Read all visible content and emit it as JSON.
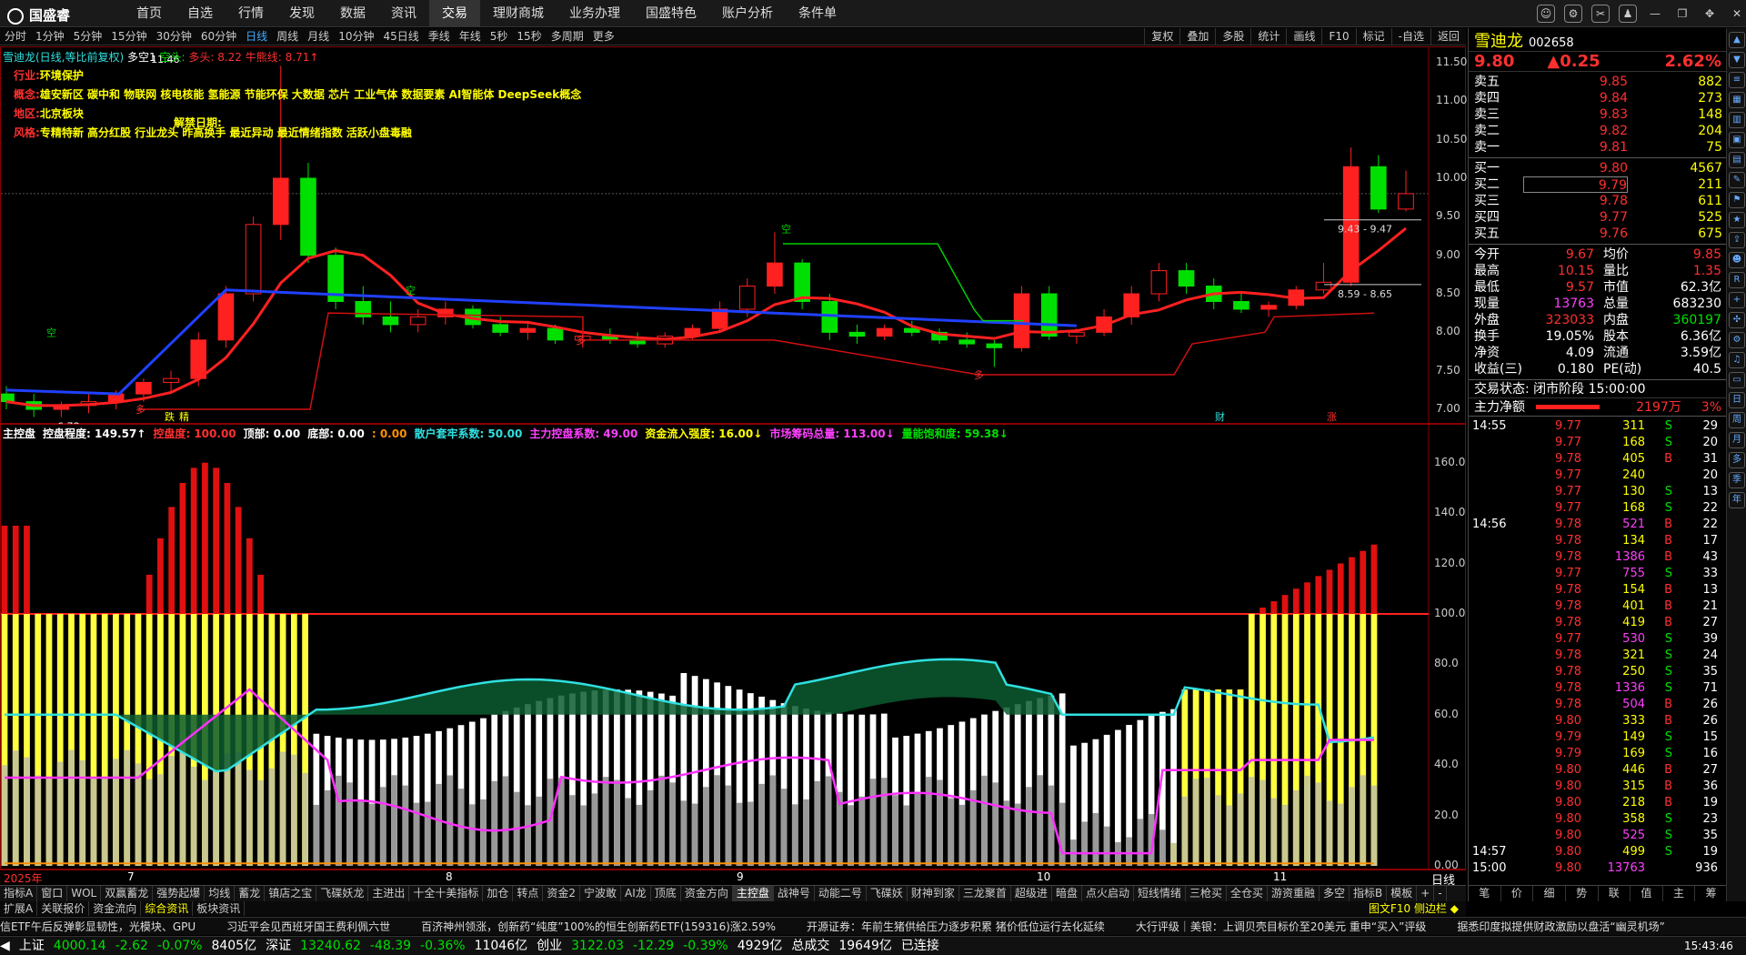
{
  "app": {
    "logo": "国盛睿",
    "nav": [
      "首页",
      "自选",
      "行情",
      "发现",
      "数据",
      "资讯",
      "交易",
      "理财商城",
      "业务办理",
      "国盛特色",
      "账户分析",
      "条件单"
    ],
    "nav_active": 6,
    "time": "15:43:46"
  },
  "period_bar": {
    "items": [
      "分时",
      "1分钟",
      "5分钟",
      "15分钟",
      "30分钟",
      "60分钟",
      "日线",
      "周线",
      "月线",
      "10分钟",
      "45日线",
      "季线",
      "年线",
      "5秒",
      "15秒",
      "多周期",
      "更多"
    ],
    "active": 6,
    "right_items": [
      "复权",
      "叠加",
      "多股",
      "统计",
      "画线",
      "F10",
      "标记",
      "-自选",
      "返回"
    ]
  },
  "main_chart": {
    "title": "雪迪龙(日线,等比前复权)",
    "mode_label": "多空1",
    "kong_label": "空头:",
    "duo_label": "多头: 8.22",
    "niu_label": "牛熊线: 8.71↑",
    "info_lines": [
      {
        "label": "行业:",
        "value": "环境保护"
      },
      {
        "label": "概念:",
        "value": "雄安新区 碳中和 物联网 核电核能 氢能源 节能环保 大数据 芯片 工业气体 数据要素 AI智能体 DeepSeek概念"
      },
      {
        "label": "地区:",
        "value": "北京板块"
      },
      {
        "label": "风格:",
        "value": "专精特新 高分红股 行业龙头 昨高换手 最近异动 最近情绪指数 活跃小盘毒融"
      }
    ],
    "jiejin_label": "解禁日期:",
    "y_ticks": [
      "11.50",
      "11.00",
      "10.50",
      "10.00",
      "9.50",
      "9.00",
      "8.50",
      "8.00",
      "7.50",
      "7.00"
    ],
    "annotations": {
      "high": "11.46",
      "low": "6.78",
      "range1": "9.43 - 9.47",
      "range2": "8.59 - 8.65",
      "kong_marker": "空",
      "duo_marker": "多",
      "die": "跌",
      "jing": "精",
      "cai": "财",
      "zhang": "涨"
    }
  },
  "chart_data": [
    {
      "type": "candlestick",
      "title": "雪迪龙(日线,等比前复权)",
      "ylim": [
        6.8,
        11.7
      ],
      "y_ticks": [
        11.5,
        11.0,
        10.5,
        10.0,
        9.5,
        9.0,
        8.5,
        8.0,
        7.5,
        7.0
      ],
      "x_ticks": [
        "2025年",
        "7",
        "8",
        "9",
        "10",
        "11"
      ],
      "ohlc_approx": [
        [
          7.2,
          7.3,
          7.0,
          7.1
        ],
        [
          7.1,
          7.2,
          6.9,
          7.0
        ],
        [
          7.0,
          7.1,
          6.9,
          7.05
        ],
        [
          7.05,
          7.2,
          6.95,
          7.1
        ],
        [
          7.1,
          7.25,
          7.0,
          7.2
        ],
        [
          7.2,
          7.4,
          7.1,
          7.35
        ],
        [
          7.35,
          7.5,
          7.2,
          7.4
        ],
        [
          7.4,
          8.0,
          7.3,
          7.9
        ],
        [
          7.9,
          8.6,
          7.8,
          8.5
        ],
        [
          8.5,
          9.5,
          8.4,
          9.4
        ],
        [
          9.4,
          11.46,
          9.2,
          10.0
        ],
        [
          10.0,
          10.2,
          8.9,
          9.0
        ],
        [
          9.0,
          9.1,
          8.3,
          8.4
        ],
        [
          8.4,
          8.6,
          8.1,
          8.2
        ],
        [
          8.2,
          8.4,
          8.0,
          8.1
        ],
        [
          8.1,
          8.3,
          8.0,
          8.2
        ],
        [
          8.2,
          8.4,
          8.1,
          8.3
        ],
        [
          8.3,
          8.35,
          8.05,
          8.1
        ],
        [
          8.1,
          8.2,
          7.95,
          8.0
        ],
        [
          8.0,
          8.15,
          7.9,
          8.05
        ],
        [
          8.05,
          8.1,
          7.85,
          7.9
        ],
        [
          7.9,
          8.05,
          7.8,
          7.95
        ],
        [
          7.95,
          8.05,
          7.85,
          7.9
        ],
        [
          7.9,
          8.0,
          7.8,
          7.85
        ],
        [
          7.85,
          8.0,
          7.8,
          7.95
        ],
        [
          7.95,
          8.1,
          7.9,
          8.05
        ],
        [
          8.05,
          8.4,
          8.0,
          8.3
        ],
        [
          8.3,
          8.7,
          8.2,
          8.6
        ],
        [
          8.6,
          9.3,
          8.5,
          8.9
        ],
        [
          8.9,
          8.95,
          8.3,
          8.4
        ],
        [
          8.4,
          8.5,
          7.9,
          8.0
        ],
        [
          8.0,
          8.1,
          7.85,
          7.95
        ],
        [
          7.95,
          8.1,
          7.9,
          8.05
        ],
        [
          8.05,
          8.15,
          7.95,
          8.0
        ],
        [
          8.0,
          8.05,
          7.85,
          7.9
        ],
        [
          7.9,
          8.0,
          7.8,
          7.85
        ],
        [
          7.85,
          7.9,
          7.55,
          7.8
        ],
        [
          7.8,
          8.6,
          7.75,
          8.5
        ],
        [
          8.5,
          8.6,
          7.9,
          7.95
        ],
        [
          7.95,
          8.05,
          7.85,
          8.0
        ],
        [
          8.0,
          8.3,
          7.95,
          8.2
        ],
        [
          8.2,
          8.6,
          8.1,
          8.5
        ],
        [
          8.5,
          8.9,
          8.4,
          8.8
        ],
        [
          8.8,
          8.9,
          8.5,
          8.6
        ],
        [
          8.6,
          8.7,
          8.3,
          8.4
        ],
        [
          8.4,
          8.5,
          8.25,
          8.3
        ],
        [
          8.3,
          8.4,
          8.2,
          8.35
        ],
        [
          8.35,
          8.6,
          8.3,
          8.55
        ],
        [
          8.55,
          8.9,
          8.5,
          8.65
        ],
        [
          8.65,
          10.4,
          8.6,
          10.15
        ],
        [
          10.15,
          10.3,
          9.55,
          9.6
        ],
        [
          9.6,
          10.1,
          9.57,
          9.8
        ]
      ]
    },
    {
      "type": "bar",
      "title": "主控盘",
      "ylim": [
        0,
        170
      ],
      "y_ticks": [
        160,
        140,
        120,
        100,
        80,
        60,
        40,
        20,
        0
      ],
      "series": [
        {
          "name": "控盘程度",
          "value": "149.57"
        },
        {
          "name": "控盘度",
          "value": "100.00"
        },
        {
          "name": "顶部",
          "value": "0.00"
        },
        {
          "name": "底部",
          "value": "0.00"
        },
        {
          "name": "散户套牢系数",
          "value": "50.00"
        },
        {
          "name": "主力控盘系数",
          "value": "49.00"
        },
        {
          "name": "资金流入强度",
          "value": "16.00"
        },
        {
          "name": "市场筹码总量",
          "value": "113.00"
        },
        {
          "name": "量能饱和度",
          "value": "59.38"
        }
      ]
    }
  ],
  "sub_chart": {
    "title": "主控盘",
    "items": [
      {
        "text": "控盘程度: 149.57↑",
        "color": "white"
      },
      {
        "text": "控盘度: 100.00",
        "color": "red"
      },
      {
        "text": "顶部: 0.00",
        "color": "white"
      },
      {
        "text": "底部: 0.00",
        "color": "white"
      },
      {
        "text": ": 0.00",
        "color": "orange"
      },
      {
        "text": "散户套牢系数: 50.00",
        "color": "cyan"
      },
      {
        "text": "主力控盘系数: 49.00",
        "color": "mag"
      },
      {
        "text": "资金流入强度: 16.00↓",
        "color": "yellow"
      },
      {
        "text": "市场筹码总量: 113.00↓",
        "color": "mag"
      },
      {
        "text": "量能饱和度: 59.38↓",
        "color": "green"
      }
    ],
    "y_ticks": [
      "160.0",
      "140.0",
      "120.0",
      "100.0",
      "80.0",
      "60.0",
      "40.0",
      "20.0",
      "0.00"
    ],
    "x_labels": [
      "2025年",
      "7",
      "8",
      "9",
      "10",
      "11"
    ],
    "x_right_label": "日线"
  },
  "quote": {
    "name": "雪迪龙",
    "code": "002658",
    "price": "9.80",
    "change": "▲0.25",
    "change_pct": "2.62%",
    "asks": [
      {
        "label": "卖五",
        "price": "9.85",
        "vol": "882"
      },
      {
        "label": "卖四",
        "price": "9.84",
        "vol": "273"
      },
      {
        "label": "卖三",
        "price": "9.83",
        "vol": "148"
      },
      {
        "label": "卖二",
        "price": "9.82",
        "vol": "204"
      },
      {
        "label": "卖一",
        "price": "9.81",
        "vol": "75"
      }
    ],
    "bids": [
      {
        "label": "买一",
        "price": "9.80",
        "vol": "4567"
      },
      {
        "label": "买二",
        "price": "9.79",
        "vol": "211"
      },
      {
        "label": "买三",
        "price": "9.78",
        "vol": "611"
      },
      {
        "label": "买四",
        "price": "9.77",
        "vol": "525"
      },
      {
        "label": "买五",
        "price": "9.76",
        "vol": "675"
      }
    ],
    "stats": [
      {
        "l1": "今开",
        "v1": "9.67",
        "c1": "red",
        "l2": "均价",
        "v2": "9.85",
        "c2": "red"
      },
      {
        "l1": "最高",
        "v1": "10.15",
        "c1": "red",
        "l2": "量比",
        "v2": "1.35",
        "c2": "red"
      },
      {
        "l1": "最低",
        "v1": "9.57",
        "c1": "red",
        "l2": "市值",
        "v2": "62.3亿",
        "c2": "white"
      },
      {
        "l1": "现量",
        "v1": "13763",
        "c1": "mag",
        "l2": "总量",
        "v2": "683230",
        "c2": "white"
      },
      {
        "l1": "外盘",
        "v1": "323033",
        "c1": "red",
        "l2": "内盘",
        "v2": "360197",
        "c2": "green"
      },
      {
        "l1": "换手",
        "v1": "19.05%",
        "c1": "white",
        "l2": "股本",
        "v2": "6.36亿",
        "c2": "white"
      },
      {
        "l1": "净资",
        "v1": "4.09",
        "c1": "white",
        "l2": "流通",
        "v2": "3.59亿",
        "c2": "white"
      },
      {
        "l1": "收益(三)",
        "v1": "0.180",
        "c1": "white",
        "l2": "PE(动)",
        "v2": "40.5",
        "c2": "white"
      }
    ],
    "trade_status": "交易状态: 闭市阶段 15:00:00",
    "net_label": "主力净额",
    "net_value": "2197万",
    "net_pct": "3%",
    "ticks": [
      {
        "t": "14:55",
        "p": "9.77",
        "v": "311",
        "d": "S",
        "n": "29"
      },
      {
        "t": "",
        "p": "9.77",
        "v": "168",
        "d": "S",
        "n": "20"
      },
      {
        "t": "",
        "p": "9.78",
        "v": "405",
        "d": "B",
        "n": "31"
      },
      {
        "t": "",
        "p": "9.77",
        "v": "240",
        "d": "",
        "n": "20"
      },
      {
        "t": "",
        "p": "9.77",
        "v": "130",
        "d": "S",
        "n": "13"
      },
      {
        "t": "",
        "p": "9.77",
        "v": "168",
        "d": "S",
        "n": "22"
      },
      {
        "t": "14:56",
        "p": "9.78",
        "v": "521",
        "d": "B",
        "n": "22"
      },
      {
        "t": "",
        "p": "9.78",
        "v": "134",
        "d": "B",
        "n": "17"
      },
      {
        "t": "",
        "p": "9.78",
        "v": "1386",
        "d": "B",
        "n": "43"
      },
      {
        "t": "",
        "p": "9.77",
        "v": "755",
        "d": "S",
        "n": "33"
      },
      {
        "t": "",
        "p": "9.78",
        "v": "154",
        "d": "B",
        "n": "13"
      },
      {
        "t": "",
        "p": "9.78",
        "v": "401",
        "d": "B",
        "n": "21"
      },
      {
        "t": "",
        "p": "9.78",
        "v": "419",
        "d": "B",
        "n": "27"
      },
      {
        "t": "",
        "p": "9.77",
        "v": "530",
        "d": "S",
        "n": "39"
      },
      {
        "t": "",
        "p": "9.78",
        "v": "321",
        "d": "S",
        "n": "24"
      },
      {
        "t": "",
        "p": "9.78",
        "v": "250",
        "d": "S",
        "n": "35"
      },
      {
        "t": "",
        "p": "9.78",
        "v": "1336",
        "d": "S",
        "n": "71"
      },
      {
        "t": "",
        "p": "9.78",
        "v": "504",
        "d": "B",
        "n": "26"
      },
      {
        "t": "",
        "p": "9.80",
        "v": "333",
        "d": "B",
        "n": "26"
      },
      {
        "t": "",
        "p": "9.79",
        "v": "149",
        "d": "S",
        "n": "15"
      },
      {
        "t": "",
        "p": "9.79",
        "v": "169",
        "d": "S",
        "n": "16"
      },
      {
        "t": "",
        "p": "9.80",
        "v": "446",
        "d": "B",
        "n": "27"
      },
      {
        "t": "",
        "p": "9.80",
        "v": "315",
        "d": "B",
        "n": "36"
      },
      {
        "t": "",
        "p": "9.80",
        "v": "218",
        "d": "B",
        "n": "19"
      },
      {
        "t": "",
        "p": "9.80",
        "v": "358",
        "d": "S",
        "n": "23"
      },
      {
        "t": "",
        "p": "9.80",
        "v": "525",
        "d": "S",
        "n": "35"
      },
      {
        "t": "14:57",
        "p": "9.80",
        "v": "499",
        "d": "S",
        "n": "19"
      },
      {
        "t": "15:00",
        "p": "9.80",
        "v": "13763",
        "d": "",
        "n": "936"
      }
    ],
    "bottom_tabs": [
      "笔",
      "价",
      "细",
      "势",
      "联",
      "值",
      "主",
      "筹"
    ]
  },
  "indicator_tabs": [
    "指标A",
    "窗口",
    "WOL",
    "双赢蓄龙",
    "强势起爆",
    "均线",
    "蓄龙",
    "镇店之宝",
    "飞碟妖龙",
    "主进出",
    "十全十美指标",
    "加仓",
    "转点",
    "资金2",
    "宁波敢",
    "AI龙",
    "顶底",
    "资金方向",
    "主控盘",
    "战神号",
    "动能二号",
    "飞碟妖",
    "财神到家",
    "三龙聚首",
    "超级进",
    "暗盘",
    "点火启动",
    "短线情绪",
    "三枪买",
    "全仓买",
    "游资重融",
    "多空",
    "指标B",
    "模板",
    "+",
    "-"
  ],
  "indicator_active": 18,
  "side_tabs": [
    "扩展A",
    "关联报价",
    "资金流向",
    "综合资讯",
    "板块资讯"
  ],
  "side_tabs_right": "图文F10 侧边栏 ◆",
  "news": [
    "信ETF午后反弹彰显韧性，光模块、GPU",
    "习近平会见西班牙国王费利佩六世",
    "百济神州领涨，创新药“纯度”100%的恒生创新药ETF(159316)涨2.59%",
    "开源证券：年前生猪供给压力逐步积累 猪价低位运行去化延续",
    "大行评级｜美银：上调贝壳目标价至20美元 重申“买入”评级",
    "据悉印度拟提供财政激励以盘活“幽灵机场”"
  ],
  "status": {
    "items": [
      {
        "label": "上证",
        "v": "4000.14",
        "c": "-2.62",
        "p": "-0.07%",
        "a": "8405亿"
      },
      {
        "label": "深证",
        "v": "13240.62",
        "c": "-48.39",
        "p": "-0.36%",
        "a": "11046亿"
      },
      {
        "label": "创业",
        "v": "3122.03",
        "c": "-12.29",
        "p": "-0.39%",
        "a": "4929亿"
      }
    ],
    "total_label": "总成交",
    "total": "19649亿",
    "connected": "已连接"
  }
}
